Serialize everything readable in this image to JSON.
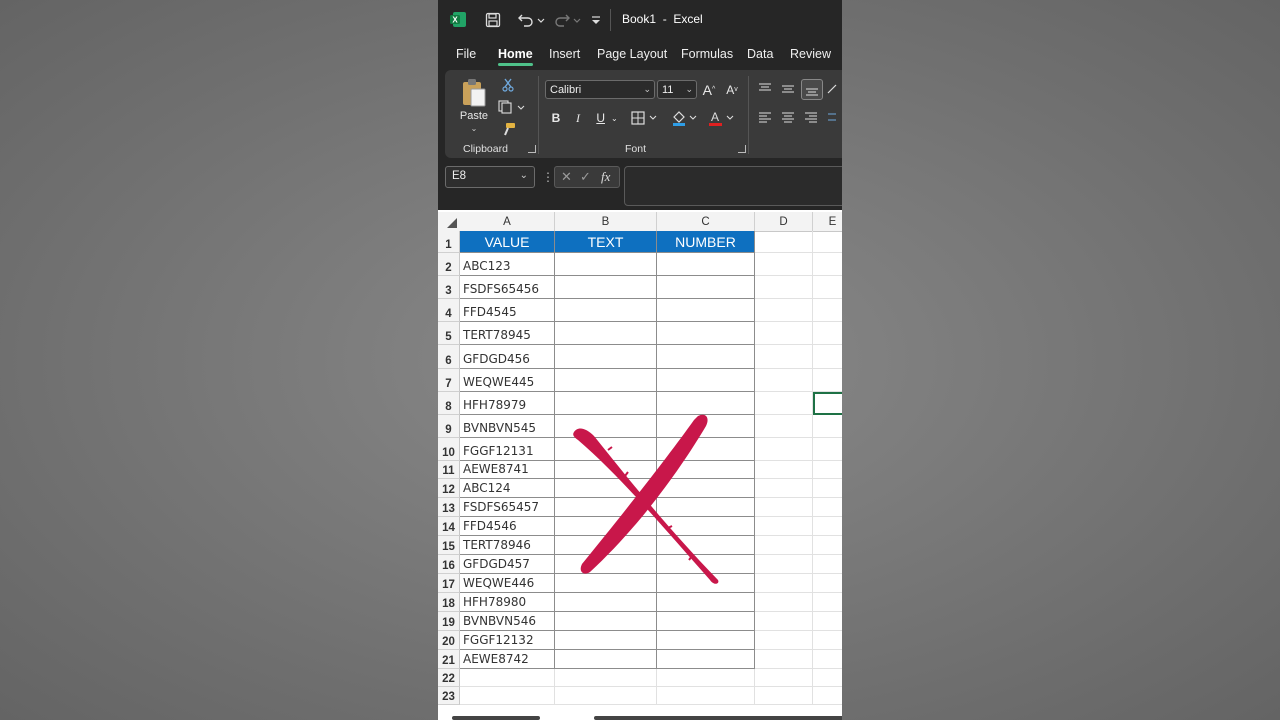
{
  "titlebar": {
    "doc_title": "Book1  -  Excel"
  },
  "tabs": [
    "File",
    "Home",
    "Insert",
    "Page Layout",
    "Formulas",
    "Data",
    "Review"
  ],
  "active_tab": "Home",
  "ribbon": {
    "clipboard": {
      "paste_label": "Paste",
      "group_label": "Clipboard"
    },
    "font": {
      "font_name": "Calibri",
      "font_size": "11",
      "group_label": "Font"
    }
  },
  "formula_bar": {
    "name_box": "E8",
    "fx_label": "fx",
    "formula": ""
  },
  "grid": {
    "columns": [
      "A",
      "B",
      "C",
      "D",
      "E"
    ],
    "headers": [
      "VALUE",
      "TEXT",
      "NUMBER"
    ],
    "rows": [
      "ABC123",
      "FSDFS65456",
      "FFD4545",
      "TERT78945",
      "GFDGD456",
      "WEQWE445",
      "HFH78979",
      "BVNBVN545",
      "FGGF12131",
      "AEWE8741",
      "ABC124",
      "FSDFS65457",
      "FFD4546",
      "TERT78946",
      "GFDGD457",
      "WEQWE446",
      "HFH78980",
      "BVNBVN546",
      "FGGF12132",
      "AEWE8742"
    ],
    "extra_row_numbers": [
      "22",
      "23"
    ],
    "selected_cell": "E8"
  },
  "colors": {
    "header_fill": "#0e70c0",
    "cross_mark": "#c8174a",
    "selection": "#1e7145",
    "excel_green": "#1d6f42"
  },
  "icons": {
    "excel_logo": "excel-logo-icon",
    "cross_mark": "red-x-mark"
  }
}
